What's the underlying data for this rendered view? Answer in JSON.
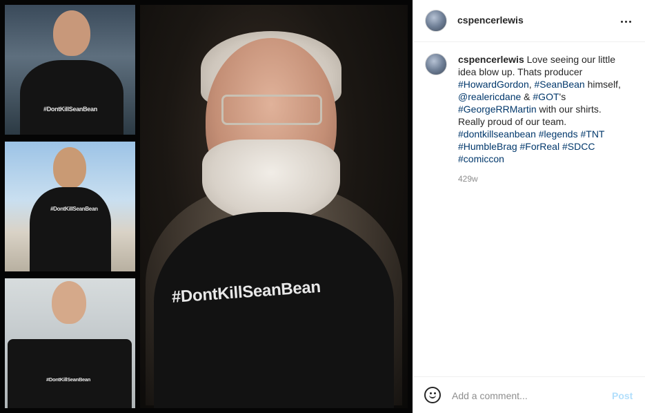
{
  "post": {
    "image": {
      "collage_tile_1_shirt_text": "#DontKillSeanBean",
      "collage_tile_2_shirt_text": "#DontKillSeanBean",
      "collage_tile_3_shirt_text": "#DontKillSeanBean",
      "main_shirt_text": "#DontKillSeanBean"
    },
    "header": {
      "username": "cspencerlewis",
      "more_icon": "more-horizontal-icon"
    },
    "caption": {
      "username": "cspencerlewis",
      "segments": [
        {
          "text": " Love seeing our little idea blow up. Thats producer ",
          "type": "text"
        },
        {
          "text": "#HowardGordon",
          "type": "tag"
        },
        {
          "text": ", ",
          "type": "text"
        },
        {
          "text": "#SeanBean",
          "type": "tag"
        },
        {
          "text": " himself, ",
          "type": "text"
        },
        {
          "text": "@realericdane",
          "type": "tag"
        },
        {
          "text": " & ",
          "type": "text"
        },
        {
          "text": "#GOT",
          "type": "tag"
        },
        {
          "text": "'s ",
          "type": "text"
        },
        {
          "text": "#GeorgeRRMartin",
          "type": "tag"
        },
        {
          "text": " with our shirts. Really proud of our team. ",
          "type": "text"
        },
        {
          "text": "#dontkillseanbean",
          "type": "tag"
        },
        {
          "text": " ",
          "type": "text"
        },
        {
          "text": "#legends",
          "type": "tag"
        },
        {
          "text": " ",
          "type": "text"
        },
        {
          "text": "#TNT",
          "type": "tag"
        },
        {
          "text": " ",
          "type": "text"
        },
        {
          "text": "#HumbleBrag",
          "type": "tag"
        },
        {
          "text": " ",
          "type": "text"
        },
        {
          "text": "#ForReal",
          "type": "tag"
        },
        {
          "text": " ",
          "type": "text"
        },
        {
          "text": "#SDCC",
          "type": "tag"
        },
        {
          "text": " ",
          "type": "text"
        },
        {
          "text": "#comiccon",
          "type": "tag"
        }
      ],
      "time": "429w"
    },
    "footer": {
      "emoji_icon": "smiley-icon",
      "comment_placeholder": "Add a comment...",
      "post_label": "Post"
    }
  },
  "colors": {
    "link": "#00376b",
    "muted": "#8e8e8e",
    "post_disabled": "#b2dffc",
    "text": "#262626",
    "divider": "#efefef"
  }
}
